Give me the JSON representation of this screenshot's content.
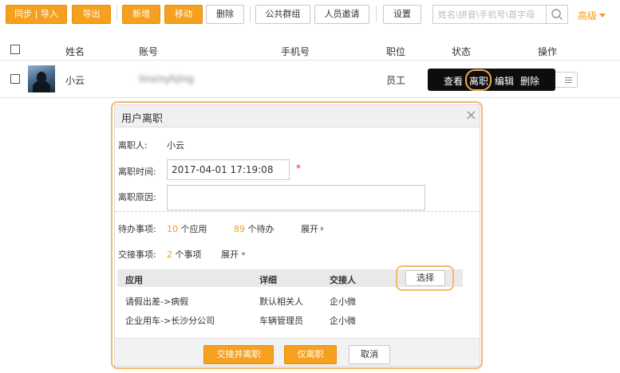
{
  "toolbar": {
    "sync_import": "同步 | 导入",
    "export": "导出",
    "add": "新增",
    "move": "移动",
    "delete": "删除",
    "public_group": "公共群组",
    "invite": "人员邀请",
    "settings": "设置",
    "search_placeholder": "姓名\\拼音\\手机号\\首字母",
    "advanced": "高级"
  },
  "table": {
    "headers": [
      "姓名",
      "账号",
      "手机号",
      "职位",
      "状态",
      "操作"
    ],
    "rows": [
      {
        "name": "小云",
        "account": "linxinyhjing",
        "position": "员工"
      }
    ]
  },
  "tooltip": {
    "view": "查看",
    "resign": "离职",
    "edit": "编辑",
    "delete": "删除"
  },
  "dialog": {
    "title": "用户离职",
    "close": "×",
    "person_label": "离职人:",
    "person_value": "小云",
    "time_label": "离职时间:",
    "time_value": "2017-04-01 17:19:08",
    "required_mark": "*",
    "reason_label": "离职原因:",
    "pending_label": "待办事项:",
    "apps_count": "10",
    "apps_unit": "个应用",
    "todo_count": "89",
    "todo_unit": "个待办",
    "expand": "展开",
    "handover_label": "交接事项:",
    "handover_count": "2",
    "handover_unit": "个事项",
    "cols": [
      "应用",
      "详细",
      "交接人"
    ],
    "select_btn": "选择",
    "items": [
      {
        "app": "请假出差->病假",
        "detail": "默认相关人",
        "handler": "企小微"
      },
      {
        "app": "企业用车->长沙分公司",
        "detail": "车辆管理员",
        "handler": "企小微"
      }
    ],
    "btn_handover_resign": "交接并离职",
    "btn_resign_only": "仅离职",
    "btn_cancel": "取消"
  },
  "colors": {
    "accent": "#f6a020",
    "highlight_ring": "#f6b86a"
  }
}
